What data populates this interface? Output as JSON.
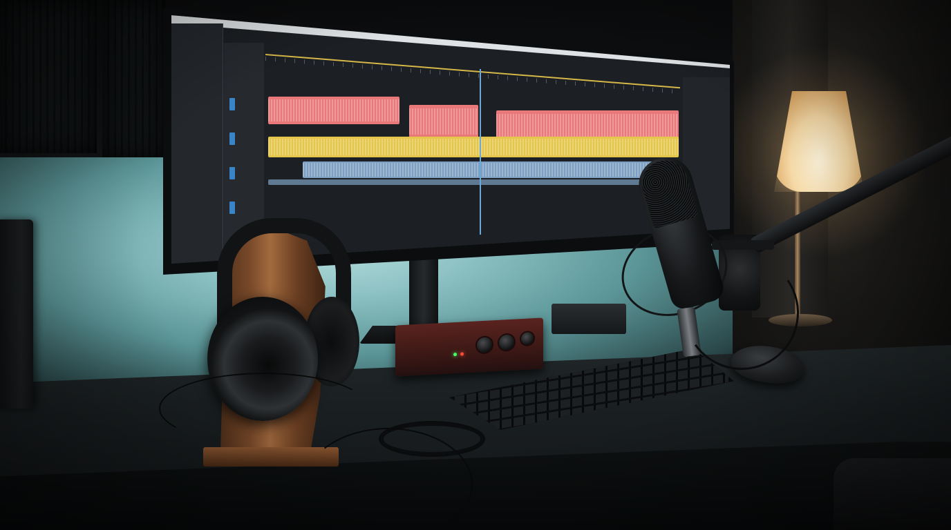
{
  "scene": {
    "description_label": "",
    "palette": {
      "wall_glow": "#8cc1c3",
      "desk": "#1a1f21",
      "lamp_light": "#f5d9a6",
      "wood": "#a26a3e",
      "track_red": "#e8787a",
      "track_yellow": "#e3c64a",
      "track_blue": "#7d9fc2",
      "interface_red": "#5a231f"
    }
  },
  "icons": {
    "headphones": "headphones-icon",
    "microphone": "microphone-icon",
    "keyboard": "keyboard-icon",
    "mouse": "mouse-icon",
    "lamp": "lamp-icon"
  }
}
